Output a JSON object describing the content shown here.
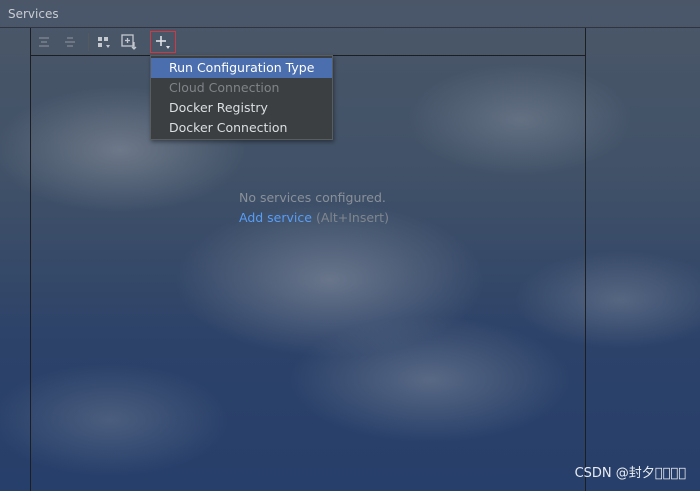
{
  "panel": {
    "title": "Services"
  },
  "toolbar": {
    "buttons": [
      {
        "icon": "expand-all-icon",
        "enabled": false
      },
      {
        "icon": "collapse-all-icon",
        "enabled": false
      },
      {
        "icon": "group-by-icon",
        "enabled": true
      },
      {
        "icon": "new-service-icon",
        "enabled": true
      },
      {
        "icon": "add-icon",
        "enabled": true,
        "highlighted": true
      }
    ]
  },
  "add_menu": {
    "items": [
      {
        "label": "Run Configuration Type",
        "state": "selected"
      },
      {
        "label": "Cloud Connection",
        "state": "disabled"
      },
      {
        "label": "Docker Registry",
        "state": "normal"
      },
      {
        "label": "Docker Connection",
        "state": "normal"
      }
    ]
  },
  "empty_state": {
    "message": "No services configured.",
    "link": "Add service",
    "shortcut": "(Alt+Insert)"
  },
  "watermark": "CSDN @封夕\u0000\u0000\u0000\u0000",
  "colors": {
    "selection": "#4b6eaf",
    "link": "#589df6",
    "highlight_border": "#d2383f"
  }
}
